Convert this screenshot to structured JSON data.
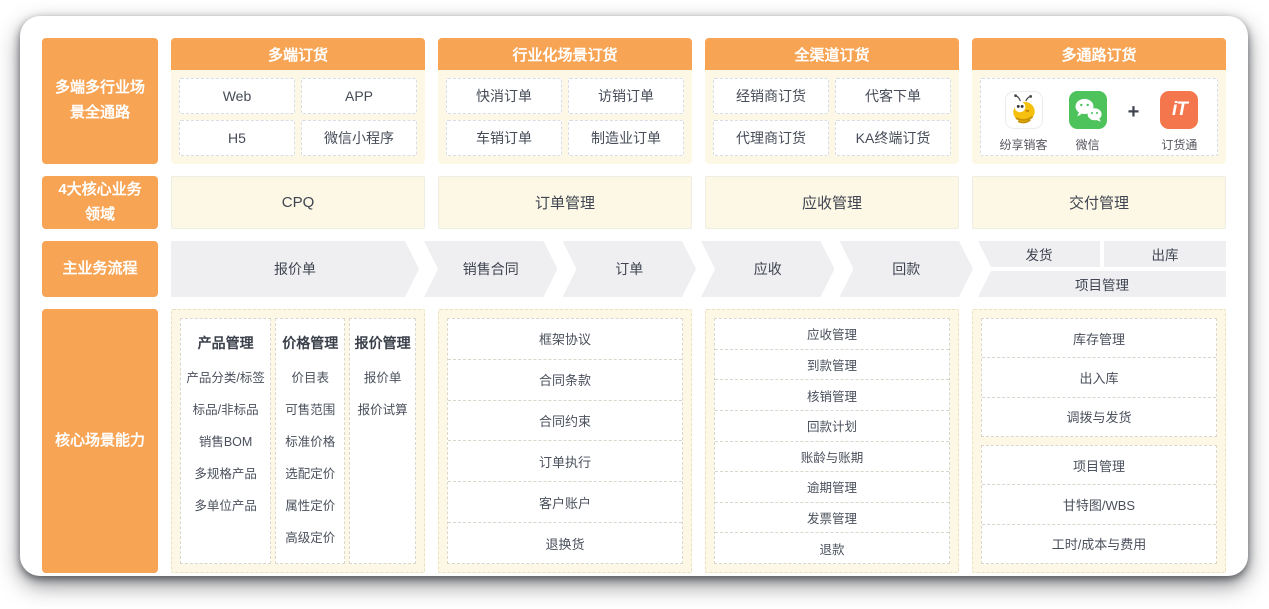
{
  "left_labels": [
    "多端多行业场景全通路",
    "4大核心业务领域",
    "主业务流程",
    "核心场景能力"
  ],
  "top_sections": [
    {
      "title": "多端订货",
      "items": [
        "Web",
        "APP",
        "H5",
        "微信小程序"
      ]
    },
    {
      "title": "行业化场景订货",
      "items": [
        "快消订单",
        "访销订单",
        "车销订单",
        "制造业订单"
      ]
    },
    {
      "title": "全渠道订货",
      "items": [
        "经销商订货",
        "代客下单",
        "代理商订货",
        "KA终端订货"
      ]
    },
    {
      "title": "多通路订货",
      "apps": [
        {
          "label": "纷享销客",
          "icon": "fenxiang-bee-icon"
        },
        {
          "label": "微信",
          "icon": "wechat-icon"
        },
        {
          "label": "订货通",
          "icon": "dinghuotong-icon",
          "glyph": "iT"
        }
      ],
      "plus": "+"
    }
  ],
  "core_domains": [
    "CPQ",
    "订单管理",
    "应收管理",
    "交付管理"
  ],
  "main_flow": {
    "steps": [
      "报价单",
      "销售合同",
      "订单",
      "应收",
      "回款"
    ],
    "branch": {
      "top": [
        "发货",
        "出库"
      ],
      "bottom": "项目管理"
    }
  },
  "capabilities": {
    "product_pricing_panel": {
      "columns": [
        {
          "header": "产品管理",
          "items": [
            "产品分类/标签",
            "标品/非标品",
            "销售BOM",
            "多规格产品",
            "多单位产品"
          ]
        },
        {
          "header": "价格管理",
          "items": [
            "价目表",
            "可售范围",
            "标准价格",
            "选配定价",
            "属性定价",
            "高级定价"
          ]
        },
        {
          "header": "报价管理",
          "items": [
            "报价单",
            "报价试算"
          ]
        }
      ]
    },
    "order_panel": [
      "框架协议",
      "合同条款",
      "合同约束",
      "订单执行",
      "客户账户",
      "退换货"
    ],
    "receivable_panel": [
      "应收管理",
      "到款管理",
      "核销管理",
      "回款计划",
      "账龄与账期",
      "逾期管理",
      "发票管理",
      "退款"
    ],
    "delivery_panel": {
      "groups": [
        [
          "库存管理",
          "出入库",
          "调拨与发货"
        ],
        [
          "项目管理",
          "甘特图/WBS",
          "工时/成本与费用"
        ]
      ]
    }
  },
  "colors": {
    "accent_orange": "#F7A455",
    "cream": "#FCF8E5",
    "flow_gray": "#EFEFF2",
    "wechat_green": "#4EC35B",
    "dinghuotong_orange": "#F4764C",
    "bee_yellow": "#F5C10E"
  }
}
